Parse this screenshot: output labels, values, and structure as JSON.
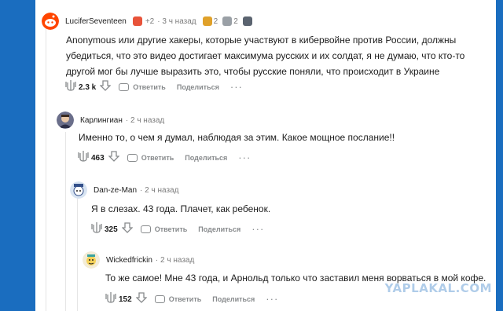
{
  "comments": [
    {
      "username": "LuciferSeventeen",
      "extra": "+2",
      "time": "· 3 ч назад",
      "awards": [
        {
          "icon": "gold-trophy-award-icon",
          "color": "#e0a12a",
          "count": "2"
        },
        {
          "icon": "helpful-award-icon",
          "color": "#9aa0a6",
          "count": "2"
        }
      ],
      "lines": [
        "Anonymous или другие хакеры, которые участвуют в кибервойне против России, должны",
        "убедиться, что это видео достигает максимума русских и их солдат, я не думаю, что кто-то",
        "другой мог бы лучше выразить это, чтобы русские поняли, что происходит в Украине"
      ],
      "score": "2.3 k",
      "reply": "Ответить",
      "share": "Поделиться"
    },
    {
      "username": "Карлингиан",
      "time": "· 2 ч назад",
      "lines": [
        "Именно то, о чем я думал, наблюдая за этим. Какое мощное послание!!"
      ],
      "score": "463",
      "reply": "Ответить",
      "share": "Поделиться"
    },
    {
      "username": "Dan-ze-Man",
      "time": "· 2 ч назад",
      "lines": [
        "Я в слезах. 43 года. Плачет, как ребенок."
      ],
      "score": "325",
      "reply": "Ответить",
      "share": "Поделиться"
    },
    {
      "username": "Wickedfrickin",
      "time": "· 2 ч назад",
      "lines": [
        "То же самое! Мне 43 года, и Арнольд только что заставил меня ворваться в мой кофе."
      ],
      "score": "152",
      "reply": "Ответить",
      "share": "Поделиться"
    }
  ],
  "watermark": "YAPLAKAL.COM",
  "colors": {
    "background": "#1a6dbf",
    "panel": "#ffffff",
    "muted": "#878a8c"
  }
}
